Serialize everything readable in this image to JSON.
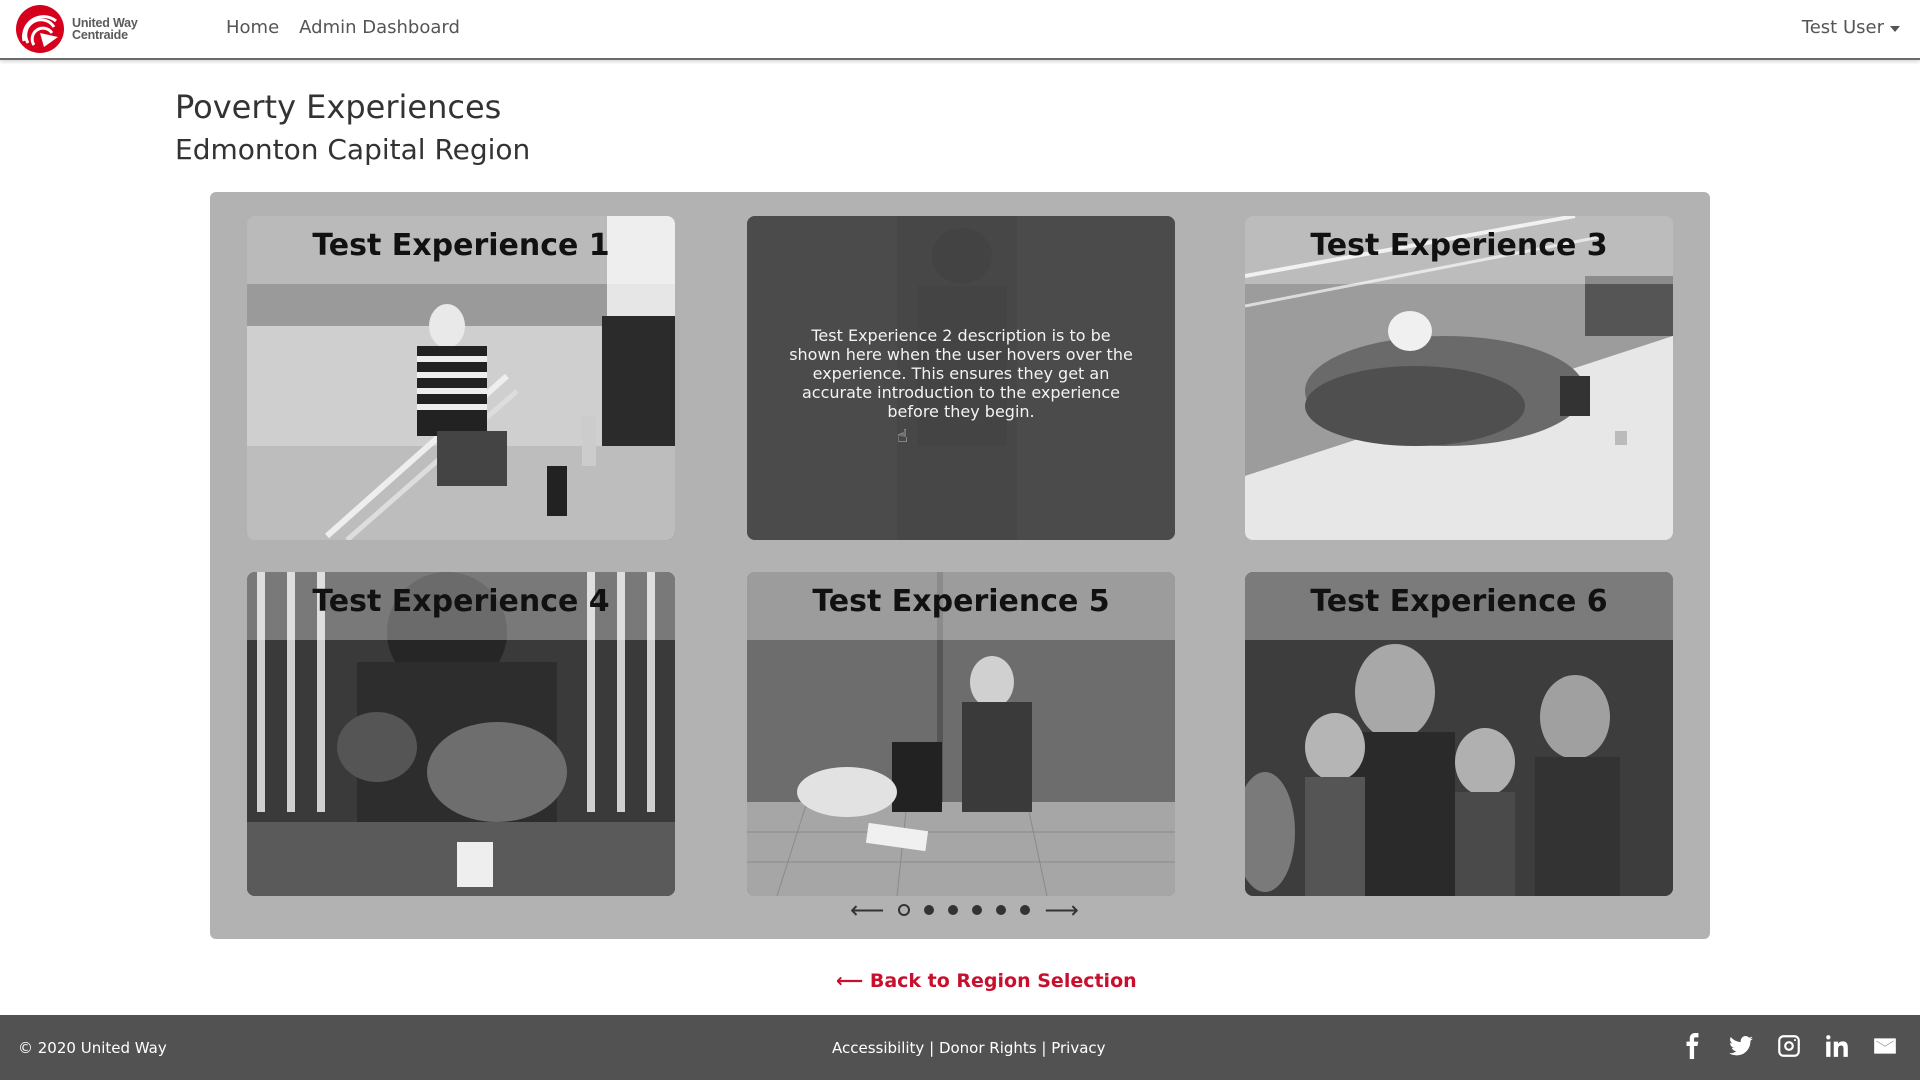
{
  "nav": {
    "logo_line1": "United Way",
    "logo_line2": "Centraide",
    "links": [
      "Home",
      "Admin Dashboard"
    ],
    "user": "Test User"
  },
  "page": {
    "title": "Poverty Experiences",
    "subtitle": "Edmonton Capital Region"
  },
  "experiences": [
    {
      "title": "Test Experience 1"
    },
    {
      "title": "Test Experience 2",
      "description": "Test Experience 2 description is to be shown here when the user hovers over the experience. This ensures they get an accurate introduction to the experience before they begin."
    },
    {
      "title": "Test Experience 3"
    },
    {
      "title": "Test Experience 4"
    },
    {
      "title": "Test Experience 5"
    },
    {
      "title": "Test Experience 6"
    }
  ],
  "pager": {
    "prev": "⟵",
    "next": "⟶",
    "pages": 6,
    "active": 1
  },
  "back_link": "⟵ Back to Region Selection",
  "footer": {
    "copyright": "© 2020 United Way",
    "links": [
      "Accessibility",
      "Donor Rights",
      "Privacy"
    ],
    "separator": "|",
    "social": [
      "facebook-icon",
      "twitter-icon",
      "instagram-icon",
      "linkedin-icon",
      "email-icon"
    ]
  },
  "colors": {
    "accent": "#c8102e",
    "footer": "#525252",
    "panel": "#b2b2b2"
  }
}
